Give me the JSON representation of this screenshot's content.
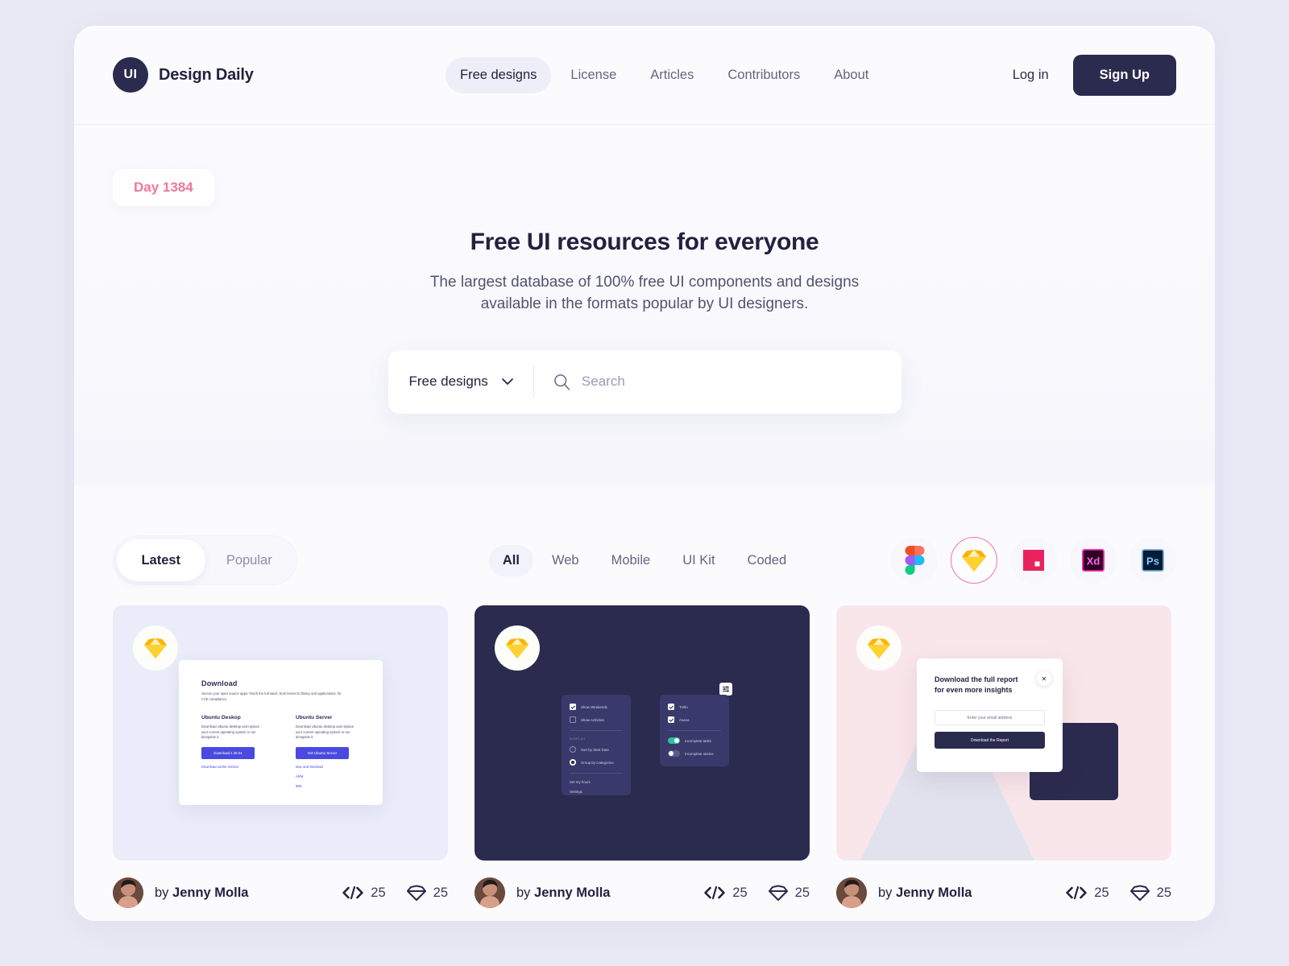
{
  "header": {
    "logo_text": "UI",
    "brand": "Design Daily",
    "nav": [
      {
        "label": "Free designs",
        "active": true
      },
      {
        "label": "License",
        "active": false
      },
      {
        "label": "Articles",
        "active": false
      },
      {
        "label": "Contributors",
        "active": false
      },
      {
        "label": "About",
        "active": false
      }
    ],
    "login_label": "Log in",
    "signup_label": "Sign Up"
  },
  "hero": {
    "day_badge": "Day 1384",
    "title": "Free UI resources for everyone",
    "subtitle_line1": "The largest database of 100% free UI components and designs",
    "subtitle_line2": "available in the formats popular by UI designers.",
    "search": {
      "category_value": "Free designs",
      "placeholder": "Search"
    }
  },
  "filters": {
    "sort": [
      {
        "label": "Latest",
        "active": true
      },
      {
        "label": "Popular",
        "active": false
      }
    ],
    "categories": [
      {
        "label": "All",
        "active": true
      },
      {
        "label": "Web",
        "active": false
      },
      {
        "label": "Mobile",
        "active": false
      },
      {
        "label": "UI Kit",
        "active": false
      },
      {
        "label": "Coded",
        "active": false
      }
    ],
    "apps": [
      {
        "name": "figma-icon",
        "selected": false
      },
      {
        "name": "sketch-icon",
        "selected": true
      },
      {
        "name": "invision-icon",
        "selected": false
      },
      {
        "name": "adobe-xd-icon",
        "selected": false
      },
      {
        "name": "photoshop-icon",
        "selected": false
      }
    ]
  },
  "colors": {
    "page_bg": "#e9e9f5",
    "app_bg": "#fbfbfe",
    "ink": "#22223f",
    "accent_pink": "#f2769c",
    "card1_bg": "#eaecf9",
    "card2_bg": "#2b2b4f",
    "card3_bg": "#f9e6ea",
    "toggle_on": "#2fbfa0",
    "ubuntu_btn": "#4a4ae0"
  },
  "cards": [
    {
      "format_icon": "sketch-icon",
      "author_prefix": "by",
      "author": "Jenny Molla",
      "code_count": "25",
      "downloads_count": "25",
      "preview": {
        "kind": "ubuntu-download",
        "heading": "Download",
        "paragraph": "Secure your open source apps. Patch the full stack, from kernel to library and applications, for CVE compliance.",
        "columns": [
          {
            "title": "Ubuntu Deskop",
            "text": "Download Ubuntu desktop and replace your current operating system or run alongside it.",
            "button": "Download s 20.04",
            "links": [
              "Download earlier version"
            ]
          },
          {
            "title": "Ubuntu Server",
            "text": "Download Ubuntu desktop and replace your current operating system or run alongside it.",
            "button": "Get Ubuntu Server",
            "links": [
              "Mac and Windows",
              "ARM",
              "IBM"
            ]
          }
        ]
      }
    },
    {
      "format_icon": "sketch-icon",
      "author_prefix": "by",
      "author": "Jenny Molla",
      "code_count": "25",
      "downloads_count": "25",
      "preview": {
        "kind": "dark-settings",
        "left_menu": {
          "checks": [
            {
              "label": "Show Weekends",
              "checked": true
            },
            {
              "label": "Show Activities",
              "checked": false
            }
          ],
          "section_caption": "DISPLAY",
          "radios": [
            {
              "label": "Sort by Start Date",
              "checked": false
            },
            {
              "label": "Group by Categories",
              "checked": true
            }
          ],
          "items": [
            "Set my hours",
            "Settings"
          ]
        },
        "right_menu": {
          "checks": [
            {
              "label": "Trello",
              "checked": true
            },
            {
              "label": "Asana",
              "checked": true
            }
          ],
          "toggles": [
            {
              "label": "Incomplete tasks",
              "on": true
            },
            {
              "label": "Incomplete stories",
              "on": false
            }
          ]
        },
        "gear_icon": "sliders-icon"
      }
    },
    {
      "format_icon": "sketch-icon",
      "author_prefix": "by",
      "author": "Jenny Molla",
      "code_count": "25",
      "downloads_count": "25",
      "preview": {
        "kind": "pink-modal",
        "title": "Download the full report for even more insights",
        "email_placeholder": "Enter your email address",
        "button": "Download the Report",
        "close_glyph": "✕"
      }
    }
  ]
}
